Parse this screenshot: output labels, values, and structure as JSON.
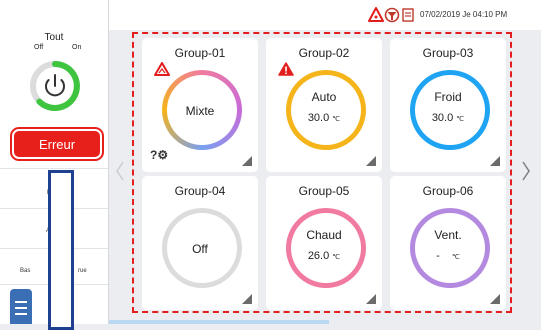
{
  "sidebar": {
    "all_title": "Tout",
    "off_label": "Off",
    "on_label": "On",
    "error_label": "Erreur",
    "item_1_label": "B",
    "item_2_label": "A",
    "item_3_label_left": "Bas",
    "item_3_label_right": "rue"
  },
  "status": {
    "datetime": "07/02/2019 Je 04:10 PM",
    "icons": [
      "warning-icon",
      "filter-icon",
      "schedule-icon"
    ]
  },
  "colors": {
    "accent_red": "#e8201c",
    "power_green": "#3ec43e",
    "mixte": "#c86bd8",
    "auto": "#f4b41a",
    "froid": "#1ea4f2",
    "off": "#dcdcdc",
    "chaud": "#f07aa0",
    "vent": "#b48ae0"
  },
  "groups": [
    {
      "name": "Group-01",
      "mode": "Mixte",
      "temp": "",
      "unit": "",
      "ring": "mixte",
      "warning": "outline",
      "icon": "help-settings-icon"
    },
    {
      "name": "Group-02",
      "mode": "Auto",
      "temp": "30.0",
      "unit": "℃",
      "ring": "auto",
      "warning": "filled"
    },
    {
      "name": "Group-03",
      "mode": "Froid",
      "temp": "30.0",
      "unit": "℃",
      "ring": "froid",
      "warning": ""
    },
    {
      "name": "Group-04",
      "mode": "Off",
      "temp": "",
      "unit": "",
      "ring": "off",
      "warning": ""
    },
    {
      "name": "Group-05",
      "mode": "Chaud",
      "temp": "26.0",
      "unit": "℃",
      "ring": "chaud",
      "warning": ""
    },
    {
      "name": "Group-06",
      "mode": "Vent.",
      "temp": "-",
      "unit": "℃",
      "ring": "vent",
      "warning": ""
    }
  ]
}
